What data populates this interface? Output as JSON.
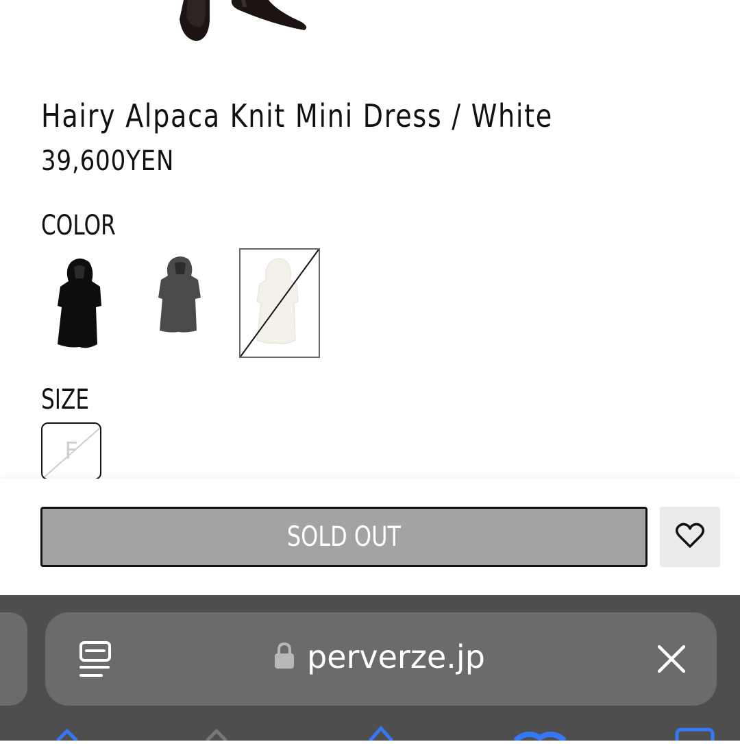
{
  "product": {
    "title": "Hairy Alpaca Knit Mini Dress / White",
    "price": "39,600YEN"
  },
  "color": {
    "label": "COLOR",
    "swatches": [
      {
        "name": "black",
        "fill": "#0d0d0d",
        "selected": false,
        "sold_out": false
      },
      {
        "name": "gray",
        "fill": "#4a4a4a",
        "selected": false,
        "sold_out": false
      },
      {
        "name": "white",
        "fill": "#f3f1ea",
        "selected": true,
        "sold_out": true
      }
    ]
  },
  "size": {
    "label": "SIZE",
    "options": [
      {
        "label": "F",
        "sold_out": true
      }
    ]
  },
  "actions": {
    "sold_out_label": "SOLD OUT",
    "favorite_icon": "heart-icon"
  },
  "browser": {
    "url": "perverze.jp",
    "reader_icon": "reader-view-icon",
    "lock_icon": "lock-icon",
    "close_icon": "close-icon"
  },
  "colors": {
    "sold_out_button_bg": "#a3a3a3",
    "browser_bar_bg": "#4e4e4e",
    "address_pill_bg": "#6b6b6b",
    "toolbar_accent": "#3478f6"
  }
}
